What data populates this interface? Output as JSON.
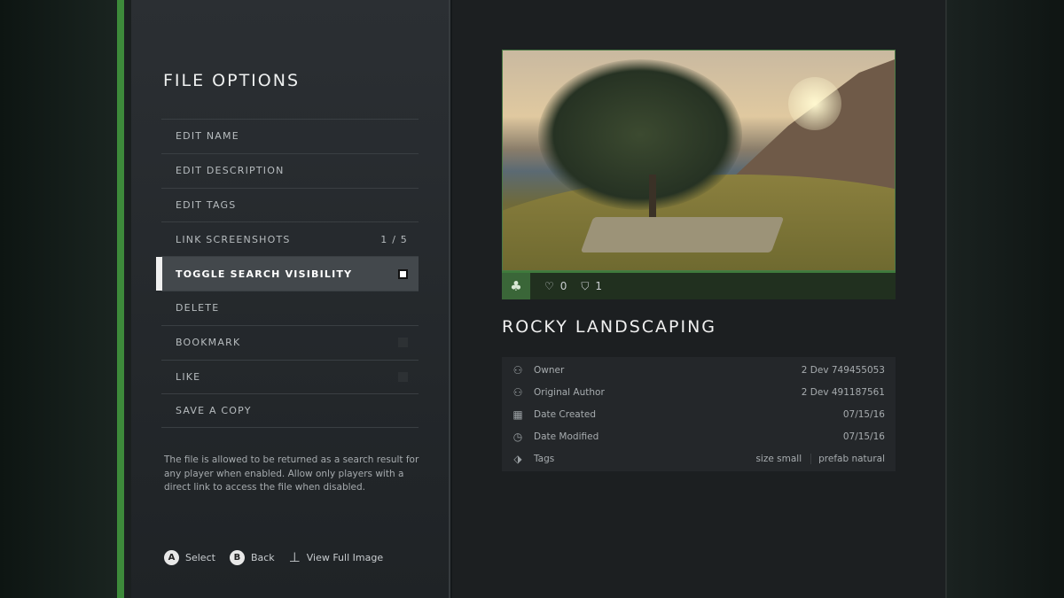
{
  "file_options": {
    "title": "FILE OPTIONS",
    "items": [
      {
        "label": "EDIT NAME"
      },
      {
        "label": "EDIT DESCRIPTION"
      },
      {
        "label": "EDIT TAGS"
      },
      {
        "label": "LINK SCREENSHOTS",
        "value": "1 / 5"
      },
      {
        "label": "TOGGLE SEARCH VISIBILITY",
        "checked": true
      },
      {
        "label": "DELETE"
      },
      {
        "label": "BOOKMARK",
        "checked": false
      },
      {
        "label": "LIKE",
        "checked": false
      },
      {
        "label": "SAVE A COPY"
      }
    ],
    "description": "The file is allowed to be returned as a search result for any player when enabled. Allow only players with a direct link to access the file when disabled."
  },
  "footer": {
    "a_glyph": "A",
    "a_label": "Select",
    "b_glyph": "B",
    "b_label": "Back",
    "view_label": "View Full Image"
  },
  "file": {
    "title": "ROCKY LANDSCAPING",
    "likes": "0",
    "bookmarks": "1",
    "owner_label": "Owner",
    "owner": "2 Dev 749455053",
    "author_label": "Original Author",
    "author": "2 Dev 491187561",
    "created_label": "Date Created",
    "created": "07/15/16",
    "modified_label": "Date Modified",
    "modified": "07/15/16",
    "tags_label": "Tags",
    "tags": [
      "size small",
      "prefab natural"
    ]
  },
  "colors": {
    "accent": "#3d8a3a"
  }
}
